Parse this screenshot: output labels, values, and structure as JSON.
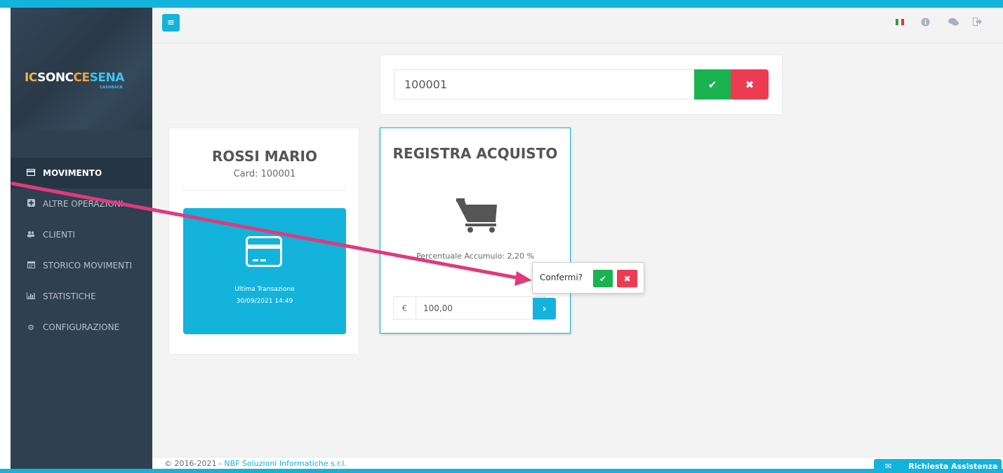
{
  "app": {
    "logo": {
      "part1": "IC",
      "part2": "SONC",
      "part3": "CE",
      "part4": "SENA",
      "sub": "CASHBACK"
    }
  },
  "sidebar": {
    "items": [
      {
        "label": "MOVIMENTO",
        "icon": "credit-card-icon"
      },
      {
        "label": "ALTRE OPERAZIONI",
        "icon": "plus-square-icon"
      },
      {
        "label": "CLIENTI",
        "icon": "users-icon"
      },
      {
        "label": "STORICO MOVIMENTI",
        "icon": "calendar-icon"
      },
      {
        "label": "STATISTICHE",
        "icon": "bar-chart-icon"
      },
      {
        "label": "CONFIGURAZIONE",
        "icon": "gear-icon"
      }
    ]
  },
  "search": {
    "value": "100001"
  },
  "client": {
    "name": "ROSSI MARIO",
    "card": "Card: 100001",
    "last_tx_label": "Ultima Transazione",
    "last_tx_date": "30/09/2021 14:49"
  },
  "purchase": {
    "title": "REGISTRA ACQUISTO",
    "percent": "Percentuale Accumulo: 2,20 %",
    "currency": "€",
    "amount": "100,00"
  },
  "popover": {
    "text": "Confermi?"
  },
  "footer": {
    "copyright": "© 2016-2021 - ",
    "company": "NBF Soluzioni Informatiche s.r.l.",
    "help": "Richiesta Assistenza"
  },
  "colors": {
    "accent": "#13b3dc",
    "success": "#1ab350",
    "danger": "#ed3b52",
    "sidebar": "#2f4050",
    "annotation_arrow": "#e03a7c"
  }
}
